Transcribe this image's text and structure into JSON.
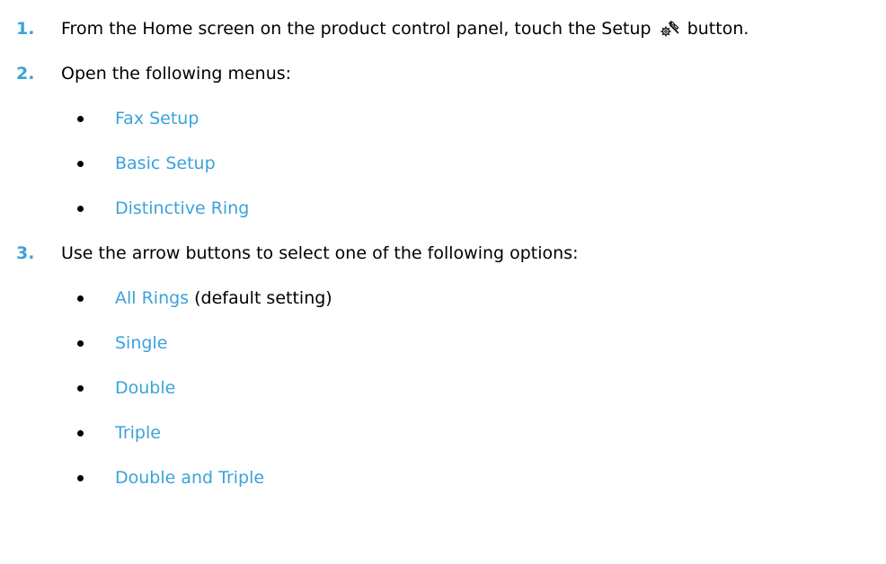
{
  "steps": [
    {
      "number": "1.",
      "text_before": "From the Home screen on the product control panel, touch the Setup",
      "icon": "setup-icon",
      "text_after": "button."
    },
    {
      "number": "2.",
      "text": "Open the following menus:",
      "items": [
        {
          "label": "Fax Setup"
        },
        {
          "label": "Basic Setup"
        },
        {
          "label": "Distinctive Ring"
        }
      ]
    },
    {
      "number": "3.",
      "text": "Use the arrow buttons to select one of the following options:",
      "items": [
        {
          "label": "All Rings",
          "suffix": "(default setting)"
        },
        {
          "label": "Single"
        },
        {
          "label": "Double"
        },
        {
          "label": "Triple"
        },
        {
          "label": "Double and Triple"
        }
      ]
    }
  ],
  "colors": {
    "accent": "#3aa3d9",
    "text": "#000000"
  }
}
